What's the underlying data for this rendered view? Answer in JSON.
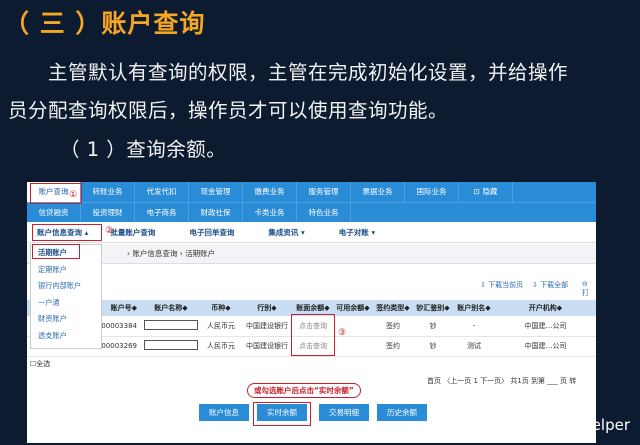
{
  "slide": {
    "title": "（ 三 ）账户查询",
    "para1": "主管默认有查询的权限，主管在完成初始化设置，并给操作",
    "para2": "员分配查询权限后，操作员才可以使用查询功能。",
    "para3": "（ 1 ）查询余额。"
  },
  "nav1": [
    "账户查询",
    "转账业务",
    "代发代扣",
    "现金管理",
    "缴费业务",
    "服务管理",
    "票据业务",
    "国际业务",
    "⊡ 隐藏"
  ],
  "nav2": [
    "信贷融资",
    "投资理财",
    "电子商务",
    "财政社保",
    "卡类业务",
    "特色业务"
  ],
  "subnav": [
    "账户信息查询 ▴",
    "批量账户查询",
    "电子回单查询",
    "集成资讯 ▾",
    "电子对账 ▾"
  ],
  "breadcrumb": "› 账户信息查询 › 活期账户",
  "dropdown": [
    "活期账户",
    "定期账户",
    "银行内部账户",
    "一户通",
    "财资账户",
    "透支账户"
  ],
  "steps": [
    "①",
    "②",
    "③"
  ],
  "download": {
    "current": "⇩ 下载当前页",
    "all": "⇩ 下载全部",
    "print": "⊖ 打"
  },
  "table": {
    "headers": [
      "",
      "账户号◆",
      "账户名称◆",
      "币种◆",
      "行别◆",
      "账面余额◆",
      "可用余额◆",
      "签约类型◆",
      "钞汇鉴别◆",
      "账户别名◆",
      "开户机构◆"
    ],
    "rows": [
      [
        "",
        "…00003384",
        "",
        "人民币元",
        "中国建设银行",
        "点击查询",
        "",
        "签约",
        "钞",
        "-",
        "中国建…公司"
      ],
      [
        "",
        "…00003269",
        "",
        "人民币元",
        "中国建设银行",
        "点击查询",
        "",
        "签约",
        "钞",
        "测试",
        "中国建…公司"
      ]
    ]
  },
  "select_all": "全选",
  "pager": "首页 〈上一页 1 下一页〉 共1页 到第 ___ 页 转",
  "callout": "或勾选账户后点击“实时余额”",
  "buttons": [
    "账户信息",
    "实时余额",
    "交易明细",
    "历史余额"
  ],
  "watermark": "头条 @会计Helper"
}
